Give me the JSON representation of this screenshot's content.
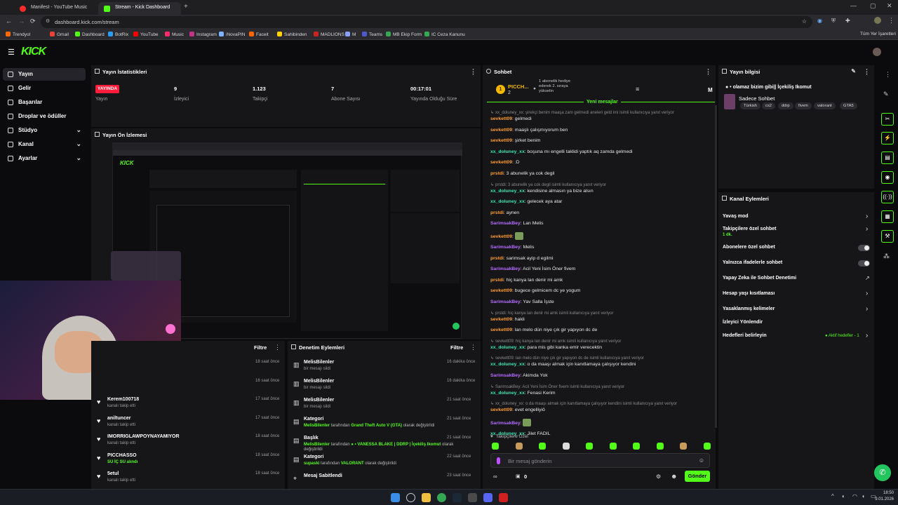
{
  "browser": {
    "tabs": [
      {
        "title": "Manifest - YouTube Music",
        "active": false,
        "color": "#ff2b2b"
      },
      {
        "title": "Stream - Kick Dashboard",
        "active": true,
        "color": "#53fc18"
      }
    ],
    "url": "dashboard.kick.com/stream",
    "bookmarks": [
      "Trendyol",
      "Gmail",
      "Dashboard",
      "BotRix",
      "YouTube",
      "Music",
      "Instagram",
      "iNovaPIN",
      "Faceit",
      "Sahibinden",
      "MADLIONS",
      "M",
      "Teams",
      "MB Ekip Form",
      "IC Ceza Kanunu"
    ],
    "bookmarks_all": "Tüm Yer İşaretleri"
  },
  "kick": {
    "logo": "KICK",
    "accent": "#53fc18"
  },
  "sidebar": {
    "items": [
      {
        "label": "Yayın",
        "active": true,
        "expandable": false
      },
      {
        "label": "Gelir",
        "active": false,
        "expandable": false
      },
      {
        "label": "Başarılar",
        "active": false,
        "expandable": false
      },
      {
        "label": "Droplar ve ödüller",
        "active": false,
        "expandable": false
      },
      {
        "label": "Stüdyo",
        "active": false,
        "expandable": true
      },
      {
        "label": "Kanal",
        "active": false,
        "expandable": true
      },
      {
        "label": "Ayarlar",
        "active": false,
        "expandable": true
      }
    ]
  },
  "stats": {
    "title": "Yayın İstatistikleri",
    "live_badge": "YAYINDA",
    "items": [
      {
        "value": "",
        "label": "Yayın"
      },
      {
        "value": "9",
        "label": "İzleyici"
      },
      {
        "value": "1.123",
        "label": "Takipçi"
      },
      {
        "value": "7",
        "label": "Abone Sayısı"
      },
      {
        "value": "00:17:01",
        "label": "Yayında Olduğu Süre"
      }
    ]
  },
  "preview": {
    "title": "Yayın Ön İzlemesi"
  },
  "activity": {
    "filter": "Filtre",
    "items": [
      {
        "name": "",
        "sub": "",
        "time": "18 saat önce"
      },
      {
        "name": "",
        "sub": "",
        "time": "16 saat önce"
      },
      {
        "name": "Kerem100718",
        "sub": "kanalı takip etti",
        "time": "17 saat önce"
      },
      {
        "name": "aniltuncer",
        "sub": "kanalı takip etti",
        "time": "17 saat önce"
      },
      {
        "name": "IMORRIGLAWPOYNAYAMIYOR",
        "sub": "kanalı takip etti",
        "time": "18 saat önce"
      },
      {
        "name": "PICCHASSO",
        "sub": "SU İÇ SU alındı",
        "time": "18 saat önce"
      },
      {
        "name": "5etul",
        "sub": "kanalı takip etti",
        "time": "18 saat önce"
      }
    ]
  },
  "moderation": {
    "title": "Denetim Eylemleri",
    "filter": "Filtre",
    "items": [
      {
        "name": "MelisBilenler",
        "sub": "bir mesajı sildi",
        "time": "16 dakika önce"
      },
      {
        "name": "MelisBilenler",
        "sub": "bir mesajı sildi",
        "time": "16 dakika önce"
      },
      {
        "name": "MelisBilenler",
        "sub": "bir mesajı sildi",
        "time": "21 saat önce"
      },
      {
        "name": "Kategori",
        "sub_user": "MelisBilenler",
        "sub_mid": " tarafından ",
        "sub_val": "Grand Theft Auto V (GTA)",
        "sub_end": " olarak değiştirildi",
        "time": "21 saat önce"
      },
      {
        "name": "Başlık",
        "sub_user": "MelisBilenler",
        "sub_mid": " tarafından ",
        "sub_val": "● • VANESSA BLAKE | DDRP | Ìçekiliş Ikomut",
        "sub_end": " olarak değiştirildi",
        "time": "21 saat önce"
      },
      {
        "name": "Kategori",
        "sub_user": "supaski",
        "sub_mid": " tarafından ",
        "sub_val": "VALORANT",
        "sub_end": " olarak değiştirildi",
        "time": "22 saat önce"
      },
      {
        "name": "Mesaj Sabitlendi",
        "sub": "",
        "time": "23 saat önce"
      }
    ]
  },
  "chat": {
    "title": "Sohbet",
    "pinned_user": "PICCH...",
    "pinned_count": "2",
    "pinned_text": "1 abonelik hediye ederek 2. sıraya yükselin",
    "new_messages": "Yeni mesajlar",
    "lines": [
      {
        "reply": "xx_doluney_xx: şirekçi benim maaşa zam gelmedi aneleri geld imi isimli kullanıcıya yanıt veriyor"
      },
      {
        "user": "sevkett09",
        "color": "orange",
        "text": "gelmedi"
      },
      {
        "user": "sevkett09",
        "color": "orange",
        "text": "maaşlı çalışmıyorum ben"
      },
      {
        "user": "sevkett09",
        "color": "orange",
        "text": "şirket benim"
      },
      {
        "user": "xx_doluney_xx",
        "color": "teal",
        "text": "boşuna mı engelli taklidi yaptık aq zamda gelmedi"
      },
      {
        "user": "sevkett09",
        "color": "orange",
        "text": ":D"
      },
      {
        "user": "prstdi",
        "color": "orange",
        "text": "3 abunelik ya cok degil"
      },
      {
        "reply": "prstdi: 3 abunelik ya cok degil isimli kullanıcıya yanıt veriyor"
      },
      {
        "user": "xx_doluney_xx",
        "color": "teal",
        "text": "kendisine almasın ya bize alsın"
      },
      {
        "user": "xx_doluney_xx",
        "color": "teal",
        "text": "gelecek aya atar"
      },
      {
        "user": "prstdi",
        "color": "orange",
        "text": "aynen"
      },
      {
        "user": "SarimsakBey",
        "color": "purple",
        "text": "Lan Melis"
      },
      {
        "user": "sevkett09",
        "color": "orange",
        "text": ""
      },
      {
        "user": "SarimsakBey",
        "color": "purple",
        "text": "Melis"
      },
      {
        "user": "prstdi",
        "color": "orange",
        "text": "sarimsak ayip d egilmi"
      },
      {
        "user": "SarimsakBey",
        "color": "purple",
        "text": "Acil Yeni İsim Öner fivem"
      },
      {
        "user": "prstdi",
        "color": "orange",
        "text": "hiç kanya lan denir mi amk"
      },
      {
        "user": "sevkett09",
        "color": "orange",
        "text": "bugece gelmicem dc ye yogum"
      },
      {
        "user": "SarimsakBey",
        "color": "purple",
        "text": "Yav Salla İşste"
      },
      {
        "reply": "prstdi: hiç kanya lan denir mi amk isimli kullanıcıya yanıt veriyor"
      },
      {
        "user": "sevkett09",
        "color": "orange",
        "text": "hakli"
      },
      {
        "user": "sevkett09",
        "color": "orange",
        "text": "lan melo dün niye çık gir yapıyon dc de"
      },
      {
        "reply": "sevkett09: hiç kanya lan denir mi amk isimli kullanıcıya yanıt veriyor"
      },
      {
        "user": "xx_doluney_xx",
        "color": "teal",
        "text": "para mis gibi kanka emir verecektin"
      },
      {
        "reply": "sevkett09: lan melo dün niye çık gir yapıyon dc de isimli kullanıcıya yanıt veriyor"
      },
      {
        "user": "xx_doluney_xx",
        "color": "teal",
        "text": "o da maaşı almak için kanıtlamaya çalışıyor kendini"
      },
      {
        "user": "SarimsakBey",
        "color": "purple",
        "text": "Akimda Yok"
      },
      {
        "reply": "SarimsakBey: Acil Yeni İsim Öner fivem isimli kullanıcıya yanıt veriyor"
      },
      {
        "user": "xx_doluney_xx",
        "color": "teal",
        "text": "Fenasi Kerim"
      },
      {
        "reply": "xx_doluney_xx: o da maaşı almak için kanıtlamaya çalışıyor kendini isimli kullanıcıya yanıt veriyor"
      },
      {
        "user": "sevkett09",
        "color": "orange",
        "text": "evet engelliyiö"
      },
      {
        "user": "SarimsakBey",
        "color": "purple",
        "text": ""
      },
      {
        "user": "xx_doluney_xx",
        "color": "teal",
        "text": "Jilet FADIL"
      }
    ],
    "followers_label": "Takipçilere Özel",
    "input_placeholder": "Bir mesaj gönderin",
    "points": "0",
    "send": "Gönder"
  },
  "stream_info": {
    "title": "Yayın bilgisi",
    "stream_title": "● • olamaz bizim gibi|| İçekiliş Ikomut",
    "category": "Sadece Sohbet",
    "tags": [
      "Türkish",
      "cs2",
      "ddrp",
      "fivem",
      "valorant",
      "GTA5"
    ]
  },
  "channel_actions": {
    "title": "Kanal Eylemleri",
    "items": [
      {
        "label": "Yavaş mod",
        "kind": "chevron"
      },
      {
        "label": "Takipçilere özel sohbet",
        "sub": "1 dk.",
        "kind": "chevron"
      },
      {
        "label": "Abonelere özel sohbet",
        "kind": "toggle"
      },
      {
        "label": "Yalnızca ifadelerle sohbet",
        "kind": "toggle"
      },
      {
        "label": "Yapay Zeka ile Sohbet Denetimi",
        "kind": "external"
      },
      {
        "label": "Hesap yaşı kısıtlaması",
        "kind": "chevron"
      },
      {
        "label": "Yasaklanmış kelimeler",
        "kind": "chevron"
      },
      {
        "label": "İzleyici Yönlendir",
        "kind": "none"
      },
      {
        "label": "Hedefleri belirleyin",
        "sub": "Aktif hedefler - 1",
        "kind": "chevron"
      }
    ]
  },
  "taskbar": {
    "time": "18:50",
    "date": "9.01.2026"
  }
}
